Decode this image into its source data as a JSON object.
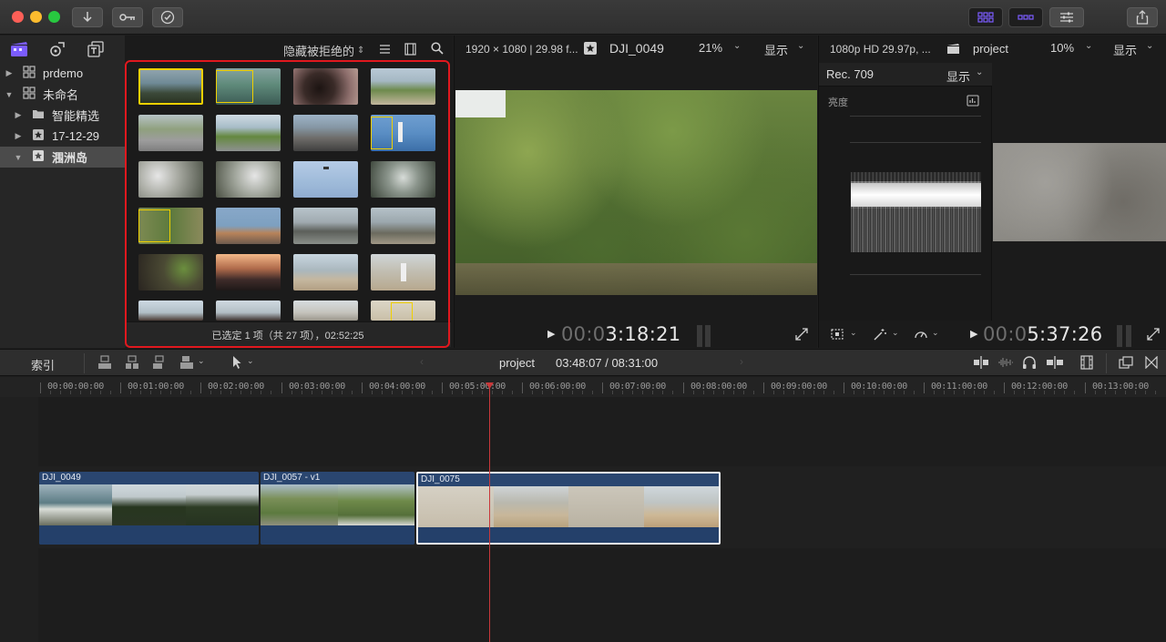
{
  "app": {
    "colors": {
      "accent": "#7b5cff",
      "highlight_border": "#e0181e",
      "selection_yellow": "#f0d000",
      "clip_blue": "#2a4670",
      "playhead": "#c8383a"
    },
    "icons": [
      "download-icon",
      "key-icon",
      "checkmark-icon",
      "layout-grid-icon",
      "layout-wide-icon",
      "inspector-icon",
      "share-icon"
    ]
  },
  "sidebar": {
    "items": [
      {
        "label": "prdemo",
        "icon": "library-grid-icon",
        "expanded": false
      },
      {
        "label": "未命名",
        "icon": "library-grid-icon",
        "expanded": true
      },
      {
        "label": "智能精选",
        "icon": "folder-icon",
        "expanded": false
      },
      {
        "label": "17-12-29",
        "icon": "event-star-icon",
        "expanded": false
      },
      {
        "label": "涠洲岛",
        "icon": "event-star-icon",
        "expanded": true,
        "selected": true
      }
    ]
  },
  "browser": {
    "filter_label": "隐藏被拒绝的",
    "footer_text": "已选定 1 项（共 27 项），02:52:25",
    "thumbs": [
      "sea-rocks",
      "lagoon",
      "blur-dark",
      "road-green",
      "road-person",
      "road-empty",
      "village-roofs",
      "lighthouse",
      "rocks-white",
      "rocks-white2",
      "sky-blue",
      "rocks-sea",
      "green-cliff",
      "statue-beach",
      "beach-rocks",
      "rock-shore",
      "cave",
      "sunset",
      "beach-person",
      "beach-walk",
      "girl-hat",
      "girl-hat2",
      "sand-shore",
      "sand-frame"
    ]
  },
  "viewer": {
    "format": "1920 × 1080 | 29.98 f...",
    "clip_name": "DJI_0049",
    "zoom": "21%",
    "display_label": "显示",
    "timecode_dim": "00:0",
    "timecode": "3:18:21"
  },
  "scopes": {
    "format": "1080p HD 29.97p, ...",
    "project_name": "project",
    "zoom": "10%",
    "display_label": "显示",
    "color_space": "Rec. 709",
    "scope_display": "显示",
    "scope_label": "亮度",
    "timecode_dim": "00:0",
    "timecode": "5:37:26"
  },
  "timeline": {
    "index_label": "索引",
    "project_name": "project",
    "time_display": "03:48:07 / 08:31:00",
    "ruler": [
      "00:00:00:00",
      "00:01:00:00",
      "00:02:00:00",
      "00:03:00:00",
      "00:04:00:00",
      "00:05:00:00",
      "00:06:00:00",
      "00:07:00:00",
      "00:08:00:00",
      "00:09:00:00",
      "00:10:00:00",
      "00:11:00:00",
      "00:12:00:00",
      "00:13:00:00"
    ],
    "clips": [
      {
        "name": "DJI_0049"
      },
      {
        "name": "DJI_0057 - v1"
      },
      {
        "name": "DJI_0075"
      }
    ]
  }
}
